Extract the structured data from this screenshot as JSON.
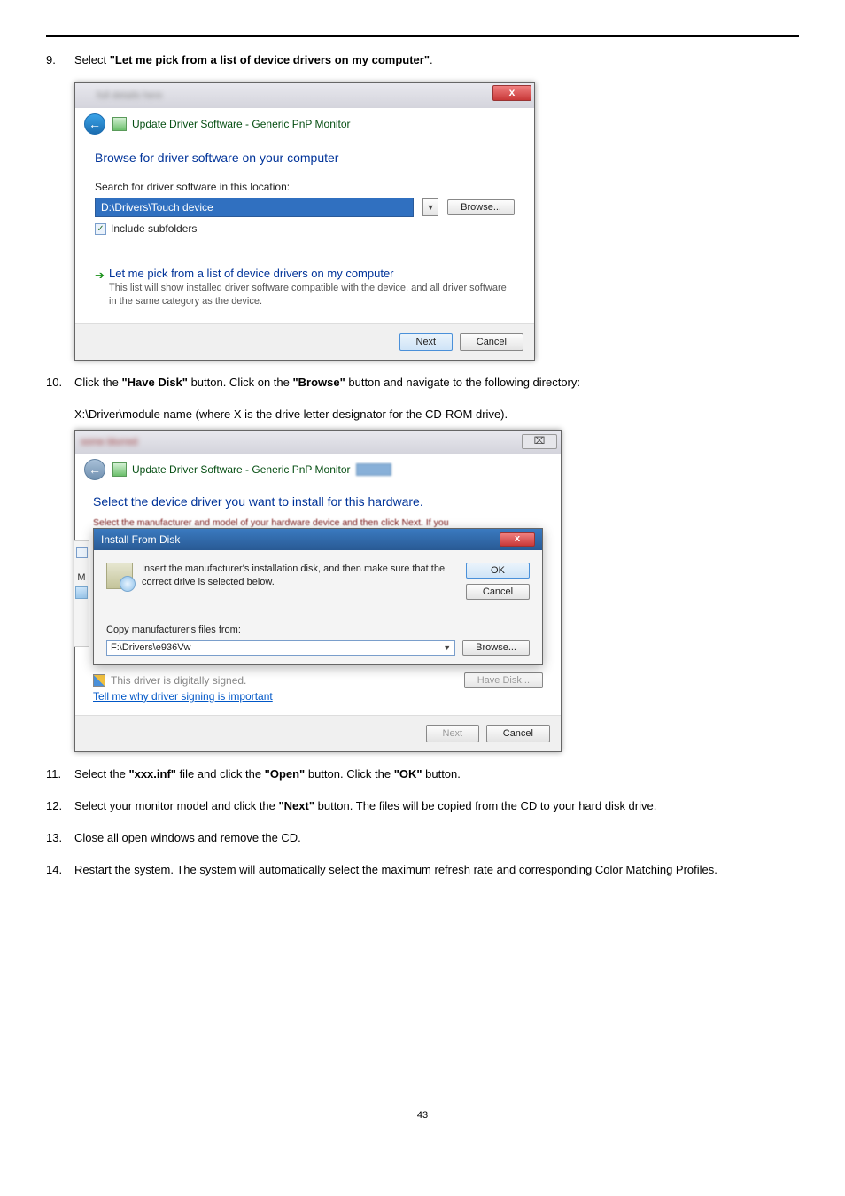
{
  "steps": {
    "s9_num": "9.",
    "s9_a": "Select ",
    "s9_b": "\"Let me pick from a list of device drivers on my computer\"",
    "s9_c": ".",
    "s10_num": "10.",
    "s10_a": "Click the ",
    "s10_b": "\"Have Disk\"",
    "s10_c": " button. Click on the ",
    "s10_d": "\"Browse\"",
    "s10_e": " button and navigate to the following directory:",
    "s10_line2": "X:\\Driver\\module name (where X is the drive letter designator for the CD-ROM drive).",
    "s11_num": "11.",
    "s11_a": "Select the ",
    "s11_b": "\"xxx.inf\"",
    "s11_c": " file and click the ",
    "s11_d": "\"Open\"",
    "s11_e": " button. Click the ",
    "s11_f": "\"OK\"",
    "s11_g": " button.",
    "s12_num": "12.",
    "s12_a": "Select your monitor model and click the ",
    "s12_b": "\"Next\"",
    "s12_c": " button. The files will be copied from the CD to your hard disk drive.",
    "s13_num": "13.",
    "s13_text": "Close all open windows and remove the CD.",
    "s14_num": "14.",
    "s14_text": "Restart the system. The system will automatically select the maximum refresh rate and corresponding Color Matching Profiles."
  },
  "dlg1": {
    "close_glyph": "x",
    "back_glyph": "←",
    "nav_title": "Update Driver Software - Generic PnP Monitor",
    "heading": "Browse for driver software on your computer",
    "search_label": "Search for driver software in this location:",
    "path_value": "D:\\Drivers\\Touch device",
    "dd_glyph": "▼",
    "browse_btn": "Browse...",
    "chk_glyph": "✓",
    "include_sub": "Include subfolders",
    "opt_arrow": "➔",
    "opt_title": "Let me pick from a list of device drivers on my computer",
    "opt_sub": "This list will show installed driver software compatible with the device, and all driver software in the same category as the device.",
    "next_btn": "Next",
    "cancel_btn": "Cancel"
  },
  "dlg2": {
    "close_glyph": "⌧",
    "back_glyph": "←",
    "nav_title": "Update Driver Software - Generic PnP Monitor",
    "heading": "Select the device driver you want to install for this hardware.",
    "red_line": "Select the manufacturer and model of your hardware device and then click Next. If you",
    "ifd_title": "Install From Disk",
    "ifd_close": "x",
    "ifd_msg": "Insert the manufacturer's installation disk, and then make sure that the correct drive is selected below.",
    "ok_btn": "OK",
    "cancel_btn": "Cancel",
    "copy_label": "Copy manufacturer's files from:",
    "path_value": "F:\\Drivers\\e936Vw",
    "dd_glyph": "▼",
    "browse_btn": "Browse...",
    "m_label": "M",
    "signed_text": "This driver is digitally signed.",
    "have_disk_btn": "Have Disk...",
    "tell_link": "Tell me why driver signing is important",
    "next_btn": "Next",
    "foot_cancel": "Cancel"
  },
  "page_number": "43"
}
